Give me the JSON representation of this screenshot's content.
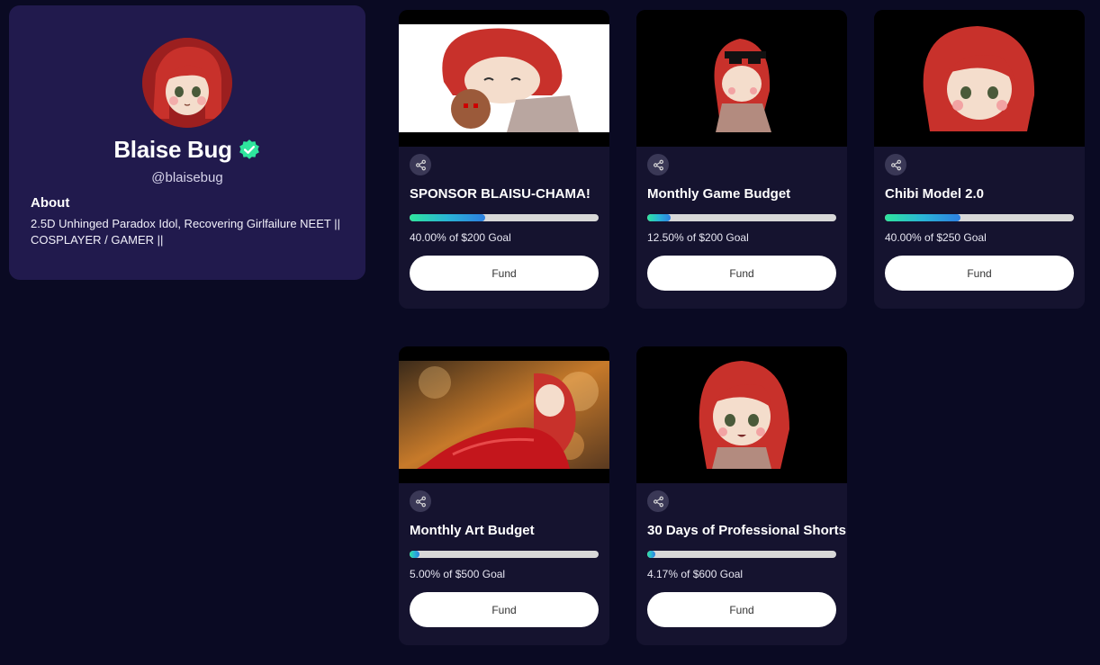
{
  "profile": {
    "name": "Blaise Bug",
    "handle": "@blaisebug",
    "about_title": "About",
    "about_text": "2.5D Unhinged Paradox Idol, Recovering Girlfailure NEET || COSPLAYER / GAMER ||",
    "verified_icon": "verified-check-icon",
    "verified_color": "#2ee59d"
  },
  "colors": {
    "page_bg": "#0a0a23",
    "profile_bg": "#211a4d",
    "card_bg": "#15132f",
    "progress_start": "#2ee59d",
    "progress_end": "#2d7fe0"
  },
  "goals": [
    {
      "title": "SPONSOR BLAISU-CHAMA!",
      "progress": 0.4,
      "goal_text": "40.00% of $200 Goal",
      "fund_label": "Fund",
      "share_icon": "share-icon"
    },
    {
      "title": "Monthly Game Budget",
      "progress": 0.125,
      "goal_text": "12.50% of $200 Goal",
      "fund_label": "Fund",
      "share_icon": "share-icon"
    },
    {
      "title": "Chibi Model 2.0",
      "progress": 0.4,
      "goal_text": "40.00% of $250 Goal",
      "fund_label": "Fund",
      "share_icon": "share-icon"
    },
    {
      "title": "Monthly Art Budget",
      "progress": 0.05,
      "goal_text": "5.00% of $500 Goal",
      "fund_label": "Fund",
      "share_icon": "share-icon"
    },
    {
      "title": "30 Days of Professional Shorts",
      "progress": 0.0417,
      "goal_text": "4.17% of $600 Goal",
      "fund_label": "Fund",
      "share_icon": "share-icon"
    }
  ]
}
